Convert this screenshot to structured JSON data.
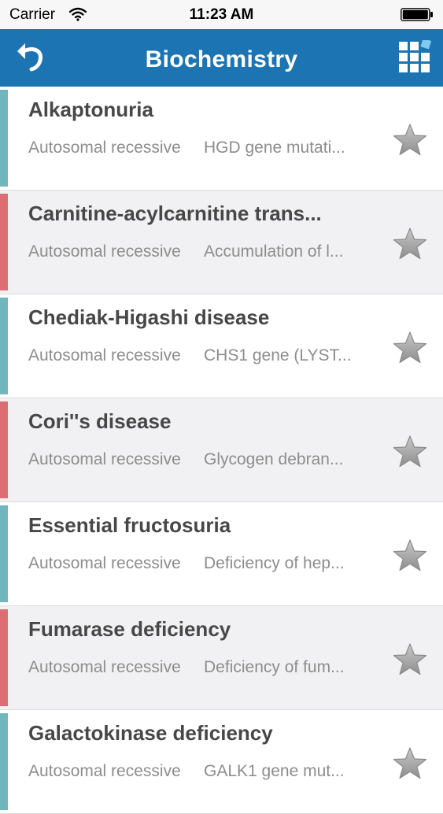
{
  "status": {
    "carrier": "Carrier",
    "time": "11:23 AM",
    "icons": [
      "wifi-icon",
      "battery-icon"
    ]
  },
  "nav": {
    "title": "Biochemistry",
    "left_icon": "back-arrow-icon",
    "right_icon": "grid-icon",
    "bar_color": "#1c74b3"
  },
  "colors": {
    "accent_teal": "#6fb6bd",
    "accent_red": "#dc6e73",
    "star": "#a9a9a9"
  },
  "list": [
    {
      "title": "Alkaptonuria",
      "inheritance": "Autosomal recessive",
      "description": "HGD gene mutati...",
      "accent": "#6fb6bd",
      "alt": false
    },
    {
      "title": "Carnitine-acylcarnitine trans...",
      "inheritance": "Autosomal recessive",
      "description": "Accumulation of l...",
      "accent": "#dc6e73",
      "alt": true
    },
    {
      "title": "Chediak-Higashi disease",
      "inheritance": "Autosomal recessive",
      "description": "CHS1 gene (LYST...",
      "accent": "#6fb6bd",
      "alt": false
    },
    {
      "title": "Cori''s disease",
      "inheritance": "Autosomal recessive",
      "description": "Glycogen debran...",
      "accent": "#dc6e73",
      "alt": true
    },
    {
      "title": "Essential fructosuria",
      "inheritance": "Autosomal recessive",
      "description": "Deficiency of hep...",
      "accent": "#6fb6bd",
      "alt": false
    },
    {
      "title": "Fumarase deficiency",
      "inheritance": "Autosomal recessive",
      "description": "Deficiency of fum...",
      "accent": "#dc6e73",
      "alt": true
    },
    {
      "title": "Galactokinase deficiency",
      "inheritance": "Autosomal recessive",
      "description": "GALK1 gene mut...",
      "accent": "#6fb6bd",
      "alt": false
    }
  ]
}
